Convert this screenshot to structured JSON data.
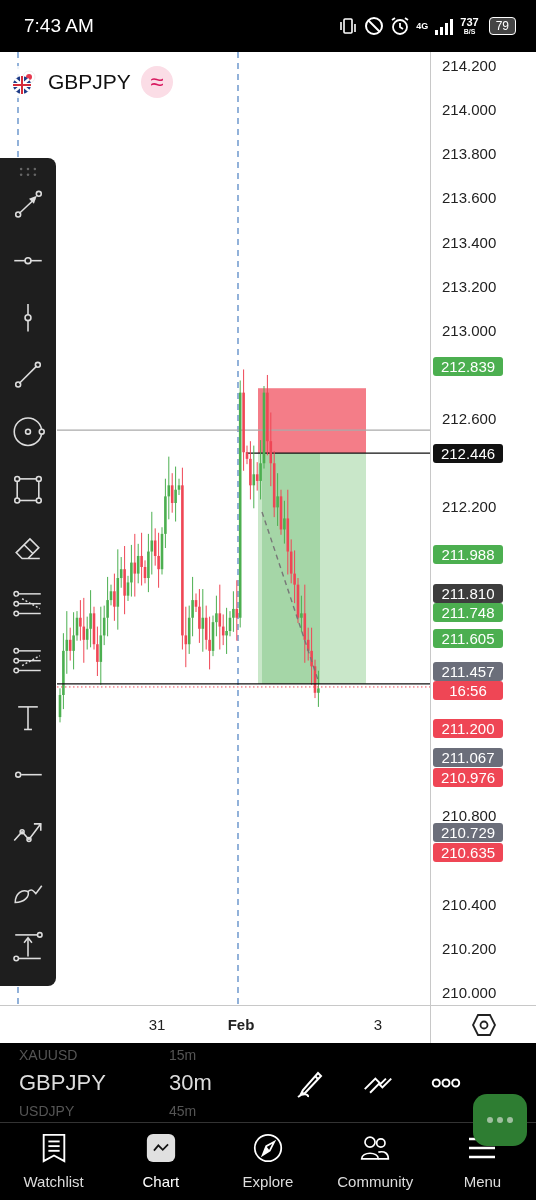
{
  "status_bar": {
    "time": "7:43 AM",
    "network": "4G",
    "speed": "737",
    "speed_unit": "B/S",
    "battery": "79"
  },
  "symbol_header": {
    "symbol": "GBPJPY",
    "chart_type_glyph": "≈"
  },
  "price_axis": [
    {
      "kind": "tick",
      "label": "214.200"
    },
    {
      "kind": "tick",
      "label": "214.000"
    },
    {
      "kind": "tick",
      "label": "213.800"
    },
    {
      "kind": "tick",
      "label": "213.600"
    },
    {
      "kind": "tick",
      "label": "213.400"
    },
    {
      "kind": "tick",
      "label": "213.200"
    },
    {
      "kind": "tick",
      "label": "213.000"
    },
    {
      "kind": "badge",
      "label": "212.839",
      "color": "#4caf50"
    },
    {
      "kind": "tick",
      "label": "212.600"
    },
    {
      "kind": "badge",
      "label": "212.446",
      "color": "#111111"
    },
    {
      "kind": "tick",
      "label": "212.200"
    },
    {
      "kind": "badge",
      "label": "211.988",
      "color": "#4caf50"
    },
    {
      "kind": "badge",
      "label": "211.810",
      "color": "#3d3d3d"
    },
    {
      "kind": "badge",
      "label": "211.748",
      "color": "#4caf50"
    },
    {
      "kind": "badge",
      "label": "211.605",
      "color": "#4caf50"
    },
    {
      "kind": "badge",
      "label": "211.457",
      "color": "#6b6e7a"
    },
    {
      "kind": "badge",
      "label": "16:56",
      "color": "#ef4655"
    },
    {
      "kind": "badge",
      "label": "211.200",
      "color": "#ef4655"
    },
    {
      "kind": "badge",
      "label": "211.067",
      "color": "#6b6e7a"
    },
    {
      "kind": "badge",
      "label": "210.976",
      "color": "#ef4655"
    },
    {
      "kind": "tick",
      "label": "210.800"
    },
    {
      "kind": "badge",
      "label": "210.729",
      "color": "#6b6e7a"
    },
    {
      "kind": "badge",
      "label": "210.635",
      "color": "#ef4655"
    },
    {
      "kind": "tick",
      "label": "210.400"
    },
    {
      "kind": "tick",
      "label": "210.200"
    },
    {
      "kind": "tick",
      "label": "210.000"
    }
  ],
  "time_axis": [
    {
      "label": "31",
      "bold": false
    },
    {
      "label": "Feb",
      "bold": true
    },
    {
      "label": "3",
      "bold": false
    }
  ],
  "symbol_picker": [
    {
      "symbol": "XAUUSD",
      "interval": "15m",
      "selected": false
    },
    {
      "symbol": "GBPJPY",
      "interval": "30m",
      "selected": true
    },
    {
      "symbol": "USDJPY",
      "interval": "45m",
      "selected": false
    }
  ],
  "nav": [
    {
      "label": "Watchlist",
      "selected": false
    },
    {
      "label": "Chart",
      "selected": true
    },
    {
      "label": "Explore",
      "selected": false
    },
    {
      "label": "Community",
      "selected": false
    },
    {
      "label": "Menu",
      "selected": false
    }
  ]
}
